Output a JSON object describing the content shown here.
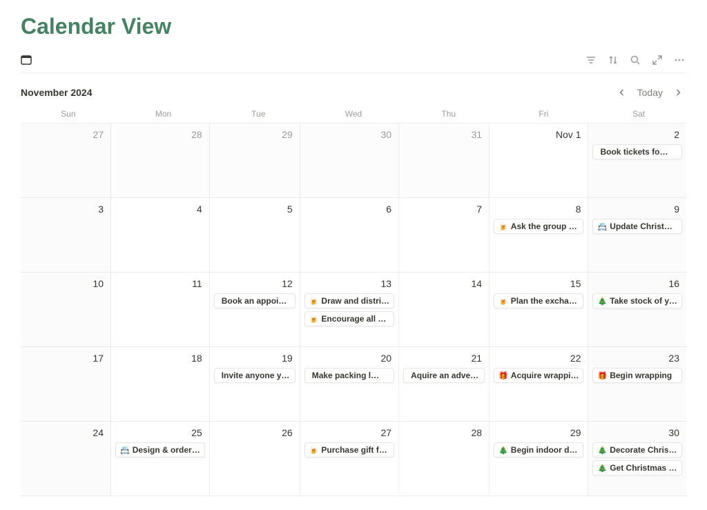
{
  "page_title": "Calendar View",
  "month_label": "November 2024",
  "today_label": "Today",
  "day_headers": [
    "Sun",
    "Mon",
    "Tue",
    "Wed",
    "Thu",
    "Fri",
    "Sat"
  ],
  "days": [
    {
      "num": "27",
      "other": true,
      "weekend": true,
      "events": []
    },
    {
      "num": "28",
      "other": true,
      "events": []
    },
    {
      "num": "29",
      "other": true,
      "events": []
    },
    {
      "num": "30",
      "other": true,
      "events": []
    },
    {
      "num": "31",
      "other": true,
      "events": []
    },
    {
      "num": "Nov 1",
      "events": []
    },
    {
      "num": "2",
      "weekend": true,
      "events": [
        {
          "emoji": "",
          "label": "Book tickets fo…"
        }
      ]
    },
    {
      "num": "3",
      "weekend": true,
      "events": []
    },
    {
      "num": "4",
      "events": []
    },
    {
      "num": "5",
      "events": []
    },
    {
      "num": "6",
      "events": []
    },
    {
      "num": "7",
      "events": []
    },
    {
      "num": "8",
      "events": [
        {
          "emoji": "🍺",
          "label": "Ask the group …"
        }
      ]
    },
    {
      "num": "9",
      "weekend": true,
      "events": [
        {
          "emoji": "📇",
          "label": "Update Christ…"
        }
      ]
    },
    {
      "num": "10",
      "weekend": true,
      "events": []
    },
    {
      "num": "11",
      "events": []
    },
    {
      "num": "12",
      "events": [
        {
          "emoji": "",
          "label": "Book an appoi…"
        }
      ]
    },
    {
      "num": "13",
      "events": [
        {
          "emoji": "🍺",
          "label": "Draw and distri…"
        },
        {
          "emoji": "🍺",
          "label": "Encourage all …"
        }
      ]
    },
    {
      "num": "14",
      "events": []
    },
    {
      "num": "15",
      "events": [
        {
          "emoji": "🍺",
          "label": "Plan the excha…"
        }
      ]
    },
    {
      "num": "16",
      "weekend": true,
      "events": [
        {
          "emoji": "🎄",
          "label": "Take stock of y…"
        }
      ]
    },
    {
      "num": "17",
      "weekend": true,
      "events": []
    },
    {
      "num": "18",
      "events": []
    },
    {
      "num": "19",
      "events": [
        {
          "emoji": "",
          "label": "Invite anyone y…"
        }
      ]
    },
    {
      "num": "20",
      "events": [
        {
          "emoji": "",
          "label": "Make packing l…"
        }
      ]
    },
    {
      "num": "21",
      "events": [
        {
          "emoji": "",
          "label": "Aquire an adve…"
        }
      ]
    },
    {
      "num": "22",
      "events": [
        {
          "emoji": "🎁",
          "label": "Acquire wrappi…"
        }
      ]
    },
    {
      "num": "23",
      "weekend": true,
      "events": [
        {
          "emoji": "🎁",
          "label": "Begin wrapping"
        }
      ]
    },
    {
      "num": "24",
      "weekend": true,
      "events": []
    },
    {
      "num": "25",
      "events": [
        {
          "emoji": "📇",
          "label": "Design & order…"
        }
      ]
    },
    {
      "num": "26",
      "events": []
    },
    {
      "num": "27",
      "events": [
        {
          "emoji": "🍺",
          "label": "Purchase gift f…"
        }
      ]
    },
    {
      "num": "28",
      "events": []
    },
    {
      "num": "29",
      "events": [
        {
          "emoji": "🎄",
          "label": "Begin indoor d…"
        }
      ]
    },
    {
      "num": "30",
      "weekend": true,
      "events": [
        {
          "emoji": "🎄",
          "label": "Decorate Chris…"
        },
        {
          "emoji": "🎄",
          "label": "Get Christmas …"
        }
      ]
    }
  ]
}
